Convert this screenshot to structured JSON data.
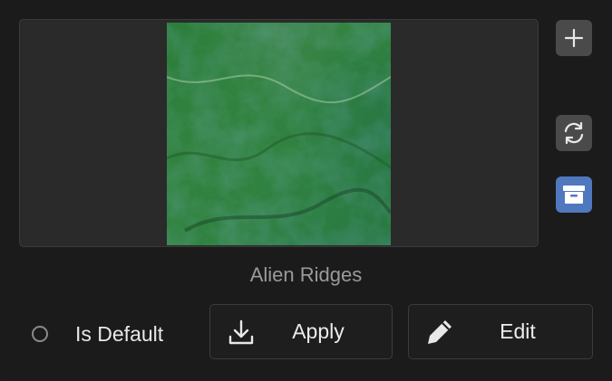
{
  "preview": {
    "name": "Alien Ridges"
  },
  "side_actions": {
    "add_icon": "plus-icon",
    "refresh_icon": "refresh-icon",
    "archive_icon": "archive-icon",
    "archive_color": "#4f78bf"
  },
  "default_option": {
    "label": "Is Default",
    "checked": false
  },
  "actions": {
    "apply_label": "Apply",
    "apply_icon": "download-icon",
    "edit_label": "Edit",
    "edit_icon": "pencil-icon"
  },
  "colors": {
    "background": "#1b1b1b",
    "button_gray": "#4a4a4a",
    "accent_blue": "#4f78bf",
    "caption": "#9a9a9a"
  }
}
